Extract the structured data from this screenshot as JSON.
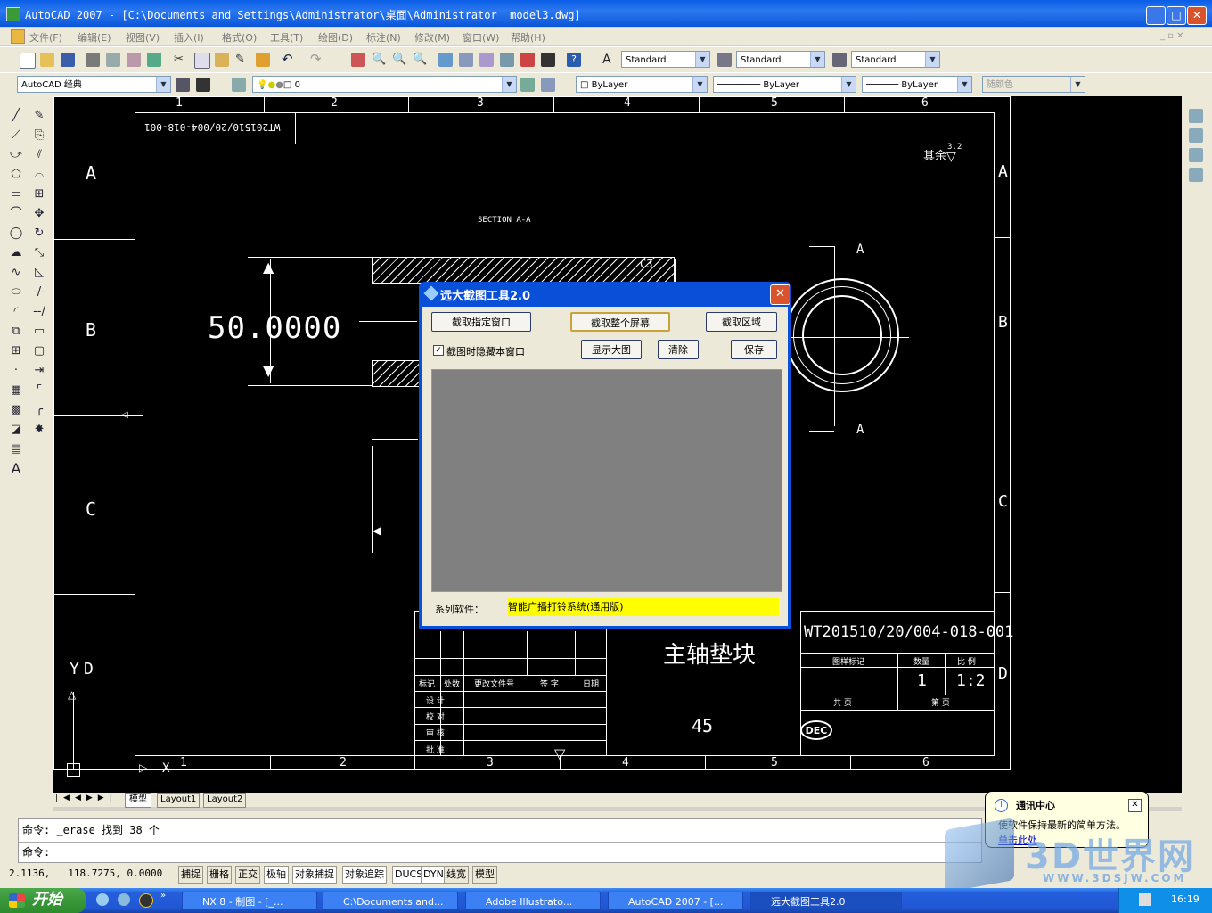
{
  "window": {
    "title": "AutoCAD 2007 - [C:\\Documents and Settings\\Administrator\\桌面\\Administrator__model3.dwg]"
  },
  "menu": [
    "文件(F)",
    "编辑(E)",
    "视图(V)",
    "插入(I)",
    "格式(O)",
    "工具(T)",
    "绘图(D)",
    "标注(N)",
    "修改(M)",
    "窗口(W)",
    "帮助(H)"
  ],
  "toolbar": {
    "text_style": "Standard",
    "dim_style": "Standard",
    "table_style": "Standard",
    "workspace": "AutoCAD 经典",
    "layer": "0",
    "color": "ByLayer",
    "linetype": "ByLayer",
    "lineweight": "ByLayer",
    "plotstyle": "随颜色"
  },
  "drawing": {
    "col_labels": [
      "1",
      "2",
      "3",
      "4",
      "5",
      "6"
    ],
    "row_labels": [
      "A",
      "B",
      "C",
      "D"
    ],
    "drawing_no_rotated": "WT201510/20/004-018-001",
    "surface_finish": "其余",
    "roughness": "3.2",
    "section_label": "SECTION A-A",
    "chamfer": "C3",
    "dimension": "50.0000",
    "section_mark": "A",
    "part_name": "主轴垫块",
    "drawing_no": "WT201510/20/004-018-001",
    "material_code": "45",
    "quantity": "1",
    "scale": "1:2",
    "title_headers": [
      "图样标记",
      "数量",
      "比 例"
    ],
    "sheet_labels": [
      "共 页",
      "第 页"
    ],
    "revision_headers": [
      "标记",
      "处数",
      "更改文件号",
      "签 字",
      "日期"
    ],
    "approval_labels": [
      "设 计",
      "校 对",
      "审 核",
      "批 准"
    ],
    "logo": "DEC",
    "ucs_y": "Y",
    "ucs_d": "D",
    "ucs_x": "X"
  },
  "layout_tabs": [
    "模型",
    "Layout1",
    "Layout2"
  ],
  "command": {
    "line1": "命令: _erase 找到 38 个",
    "line2": "命令:"
  },
  "status": {
    "coords": "2.1136,   118.7275, 0.0000",
    "toggles": [
      "捕捉",
      "栅格",
      "正交",
      "极轴",
      "对象捕捉",
      "对象追踪",
      "DUCS",
      "DYN",
      "线宽",
      "模型"
    ]
  },
  "dialog": {
    "title": "远大截图工具2.0",
    "btn_window": "截取指定窗口",
    "btn_fullscreen": "截取整个屏幕",
    "btn_region": "截取区域",
    "checkbox_label": "截图时隐藏本窗口",
    "btn_show": "显示大图",
    "btn_clear": "清除",
    "btn_save": "保存",
    "series_label": "系列软件：",
    "series_value": "智能广播打铃系统(通用版)"
  },
  "balloon": {
    "title": "通讯中心",
    "text": "使软件保持最新的简单方法。",
    "link": "单击此处"
  },
  "watermark": {
    "text": "3D世界网",
    "url": "WWW.3DSJW.COM"
  },
  "taskbar": {
    "start": "开始",
    "tasks": [
      "NX 8 - 制图 - [_...",
      "C:\\Documents and...",
      "Adobe Illustrato...",
      "AutoCAD 2007 - [...",
      "远大截图工具2.0"
    ],
    "clock": "16:19"
  },
  "colors": {
    "xp_blue": "#245edb",
    "highlight": "#ffff00",
    "canvas": "#000000"
  }
}
